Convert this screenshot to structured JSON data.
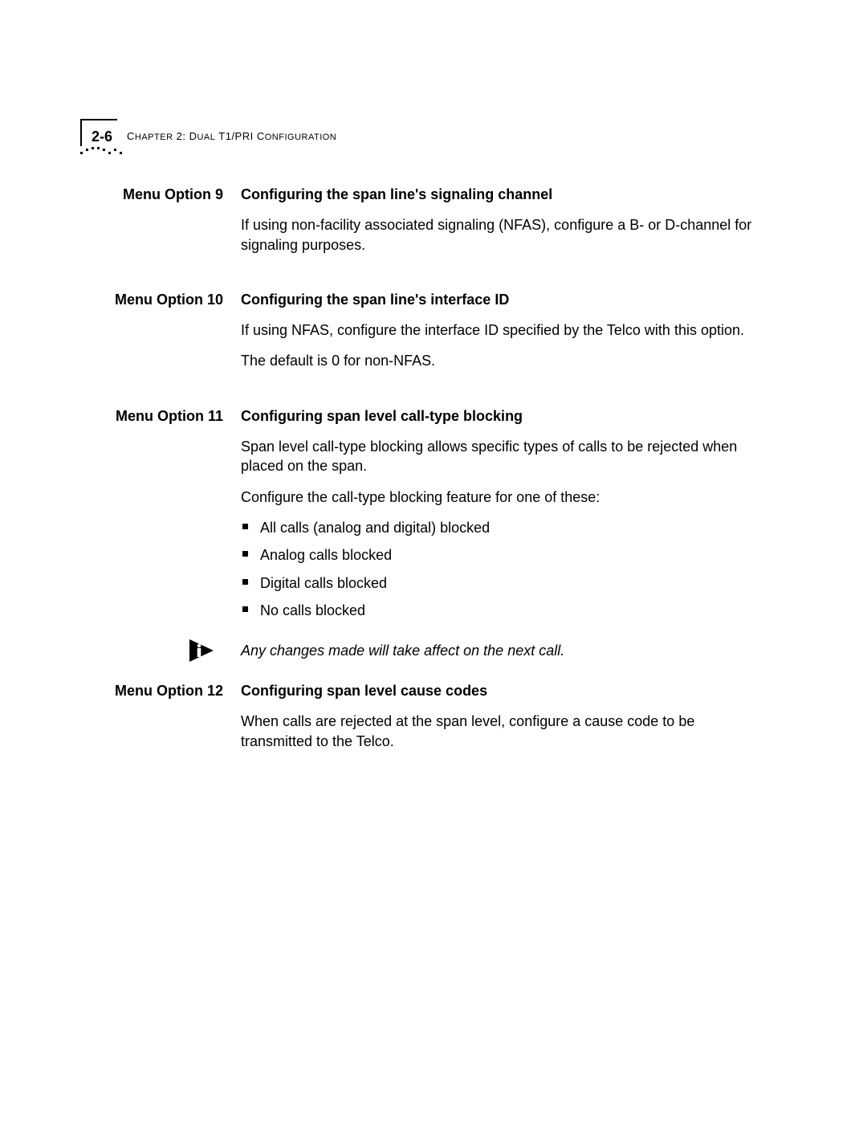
{
  "header": {
    "page_number": "2-6",
    "chapter_prefix": "C",
    "chapter_rest_sc": "HAPTER",
    "chapter_num": " 2: D",
    "chapter_rest_sc2": "UAL",
    "chapter_mid": " T1/PRI C",
    "chapter_rest_sc3": "ONFIGURATION"
  },
  "sections": [
    {
      "label": "Menu Option 9",
      "heading": "Configuring the span line's signaling channel",
      "paragraphs": [
        "If using non-facility associated signaling (NFAS), configure a B- or D-channel for signaling purposes."
      ]
    },
    {
      "label": "Menu Option 10",
      "heading": "Configuring the span line's interface ID",
      "paragraphs": [
        "If using NFAS, configure the interface ID specified by the Telco with this option.",
        "The default is 0 for non-NFAS."
      ]
    },
    {
      "label": "Menu Option 11",
      "heading": "Configuring span level call-type blocking",
      "paragraphs": [
        "Span level call-type blocking allows specific types of calls to be rejected when placed on the span.",
        "Configure the call-type blocking feature for one of these:"
      ],
      "bullets": [
        "All calls (analog and digital) blocked",
        "Analog calls blocked",
        "Digital calls blocked",
        "No calls blocked"
      ]
    }
  ],
  "note": "Any changes made will take affect on the next call.",
  "section_after_note": {
    "label": "Menu Option 12",
    "heading": "Configuring span level cause codes",
    "paragraphs": [
      "When calls are rejected at the span level, configure a cause code to be transmitted to the Telco."
    ]
  }
}
